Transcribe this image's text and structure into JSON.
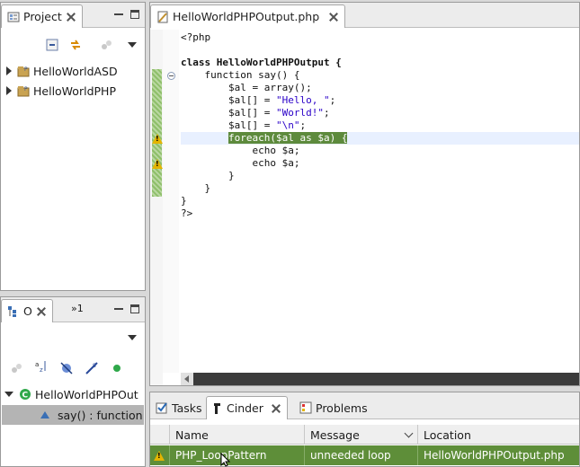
{
  "project_view": {
    "tab_label": "Project",
    "items": [
      {
        "label": "HelloWorldASD"
      },
      {
        "label": "HelloWorldPHP"
      }
    ]
  },
  "outline_view": {
    "tab_label": "O",
    "overflow_label": "»1",
    "root_label": "HelloWorldPHPOut",
    "child_label": "say() : function"
  },
  "editor": {
    "tab_label": "HelloWorldPHPOutput.php",
    "lines": [
      "<?php",
      "",
      "class HelloWorldPHPOutput {",
      "    function say() {",
      "        $al = array();",
      "        $al[] = \"Hello, \";",
      "        $al[] = \"World!\";",
      "        $al[] = \"\\n\";",
      "        foreach($al as $a) {",
      "            echo $a;",
      "            echo $a;",
      "        }",
      "    }",
      "}",
      "?>"
    ],
    "highlighted_text": "foreach($al as $a) {"
  },
  "bottom_panel": {
    "tabs": [
      {
        "label": "Tasks"
      },
      {
        "label": "Cinder"
      },
      {
        "label": "Problems"
      }
    ],
    "columns": [
      "Name",
      "Message",
      "Location"
    ],
    "rows": [
      {
        "name": "PHP_LoopPattern",
        "message": "unneeded loop",
        "location": "HelloWorldPHPOutput.php"
      }
    ]
  },
  "colors": {
    "highlight_green": "#5d8a3c",
    "warning_yellow": "#e4b400",
    "string_blue": "#2a00c8"
  }
}
